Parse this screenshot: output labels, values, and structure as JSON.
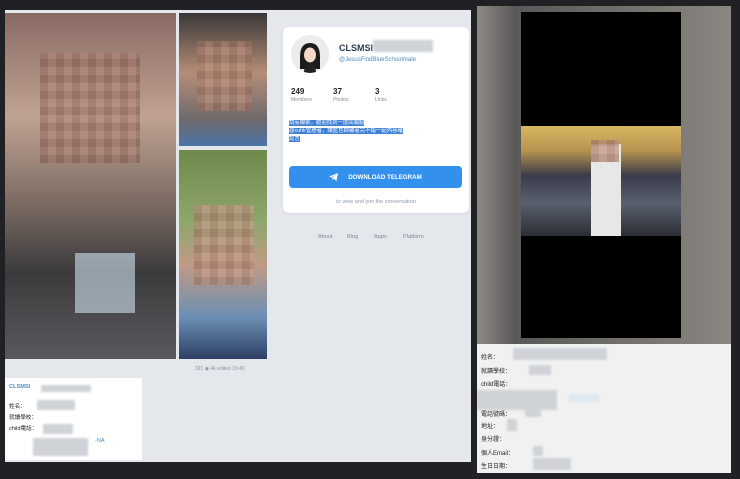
{
  "post": {
    "views": "321",
    "reactions": "4k",
    "edited": "edited 19:40"
  },
  "channel_card": {
    "name": "CLSMSI",
    "handle": "@JesusFindBlueSchoolmate",
    "stats": [
      {
        "value": "249",
        "label": "Members"
      },
      {
        "value": "37",
        "label": "Photos"
      },
      {
        "value": "3",
        "label": "Links"
      }
    ],
    "description_lines": [
      "請有線索，歡迎找到一度回報給",
      "@cuhk管理者，讓藍色師藏者完不錯一起內容確",
      "認言"
    ],
    "download_button": "DOWNLOAD TELEGRAM",
    "tagline": "to view and join the conversation"
  },
  "footer_links": [
    "About",
    "Blog",
    "Apps",
    "Platform"
  ],
  "bottom_card": {
    "name": "CLSMSI",
    "fields": [
      {
        "label": "姓名："
      },
      {
        "label": "就讀學校："
      },
      {
        "label": "child電話："
      }
    ],
    "suffix": "-NA"
  },
  "right_panel": {
    "fields": [
      {
        "label": "姓名："
      },
      {
        "label": "就讀學校："
      },
      {
        "label": "child電話："
      },
      {
        "label": "電話號碼："
      },
      {
        "label": "地址："
      },
      {
        "label": "身分證："
      },
      {
        "label": "個人Email："
      },
      {
        "label": "生日日期："
      }
    ]
  },
  "colors": {
    "accent": "#3390ec",
    "link": "#4b8ec4",
    "background": "#e4e8ec"
  }
}
